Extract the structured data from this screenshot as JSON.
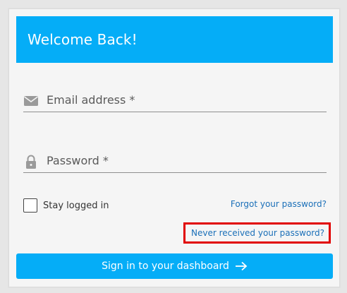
{
  "header": {
    "title": "Welcome Back!"
  },
  "form": {
    "email": {
      "placeholder": "Email address *",
      "value": "",
      "icon": "envelope-icon"
    },
    "password": {
      "placeholder": "Password *",
      "value": "",
      "icon": "lock-icon"
    },
    "remember": {
      "label": "Stay logged in",
      "checked": false
    },
    "links": {
      "forgot": "Forgot your password?",
      "never_received": "Never received your password?"
    },
    "submit": {
      "label": "Sign in to your dashboard",
      "icon": "arrow-right-icon"
    }
  },
  "colors": {
    "accent": "#05adf7",
    "link": "#1a6fb8",
    "highlight_border": "#e10000"
  }
}
